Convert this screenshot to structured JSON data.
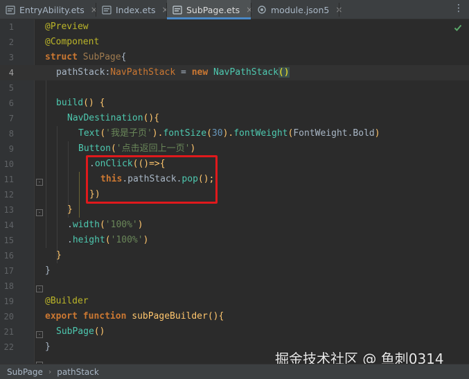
{
  "tabs": [
    {
      "name": "EntryAbility.ets",
      "active": false
    },
    {
      "name": "Index.ets",
      "active": false
    },
    {
      "name": "SubPage.ets",
      "active": true
    },
    {
      "name": "module.json5",
      "active": false
    }
  ],
  "tab_close_glyph": "×",
  "more_glyph": "⋮",
  "line_numbers": [
    "1",
    "2",
    "3",
    "4",
    "5",
    "6",
    "7",
    "8",
    "9",
    "10",
    "11",
    "12",
    "13",
    "14",
    "15",
    "16",
    "17",
    "18",
    "19",
    "20",
    "21",
    "22"
  ],
  "code": {
    "l1": {
      "ann": "@Preview"
    },
    "l2": {
      "ann": "@Component"
    },
    "l3": {
      "kw": "struct",
      "name": "SubPage",
      "brace": "{"
    },
    "l4": {
      "prop": "pathStack",
      "colon": ":",
      "type": "NavPathStack",
      "eq": " = ",
      "kw": "new",
      "ctor": "NavPathStack",
      "parens": "()"
    },
    "l6": {
      "fn": "build",
      "rest": "() {"
    },
    "l7": {
      "fn": "NavDestination",
      "rest": "(){"
    },
    "l8": {
      "fn": "Text",
      "open": "(",
      "str": "'我是子页'",
      "close": ").",
      "fn2": "fontSize",
      "open2": "(",
      "num": "30",
      "close2": ").",
      "fn3": "fontWeight",
      "open3": "(",
      "arg": "FontWeight.Bold",
      "close3": ")"
    },
    "l9": {
      "fn": "Button",
      "open": "(",
      "str": "'点击返回上一页'",
      "close": ")"
    },
    "l10": {
      "dot": ".",
      "fn": "onClick",
      "rest": "(()=>{"
    },
    "l11": {
      "kw": "this",
      "mid": ".",
      "prop": "pathStack",
      "dot": ".",
      "fn": "pop",
      "rest": "();"
    },
    "l12": {
      "text": "})"
    },
    "l13": {
      "text": "}"
    },
    "l14": {
      "dot": ".",
      "fn": "width",
      "open": "(",
      "str": "'100%'",
      "close": ")"
    },
    "l15": {
      "dot": ".",
      "fn": "height",
      "open": "(",
      "str": "'100%'",
      "close": ")"
    },
    "l16": {
      "text": "}"
    },
    "l17": {
      "text": "}"
    },
    "l19": {
      "ann": "@Builder"
    },
    "l20": {
      "kw": "export",
      "kw2": "function",
      "fn": "subPageBuilder",
      "rest": "(){"
    },
    "l21": {
      "fn": "SubPage",
      "rest": "()"
    },
    "l22": {
      "text": "}"
    }
  },
  "breadcrumbs": [
    "SubPage",
    "pathStack"
  ],
  "breadcrumb_separator": "›",
  "watermark": "掘金技术社区 @ 鱼刺0314",
  "colors": {
    "keyword": "#cc7832",
    "annotation": "#bbb529",
    "string": "#6a8759",
    "number": "#6897bb",
    "function": "#ffc66d",
    "property": "#9876aa",
    "highlight_box": "#e0191c",
    "active_tab_underline": "#4a88c7"
  },
  "icons": {
    "tab_file_icons": [
      "ets-file-icon",
      "ets-file-icon",
      "ets-file-icon",
      "json-settings-icon"
    ],
    "status": "green-check-icon"
  }
}
